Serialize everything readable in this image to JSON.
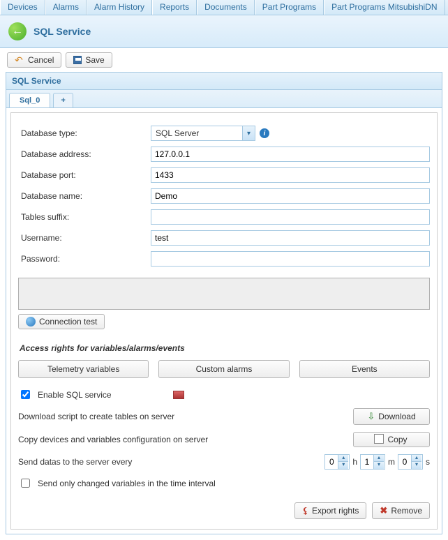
{
  "topTabs": [
    "Devices",
    "Alarms",
    "Alarm History",
    "Reports",
    "Documents",
    "Part Programs",
    "Part Programs MitsubishiDN"
  ],
  "titleBar": {
    "title": "SQL Service"
  },
  "toolbar": {
    "cancel": "Cancel",
    "save": "Save"
  },
  "panel": {
    "header": "SQL Service"
  },
  "innerTabs": {
    "tab0": "Sql_0",
    "add": "+"
  },
  "form": {
    "labels": {
      "dbType": "Database type:",
      "dbAddress": "Database address:",
      "dbPort": "Database port:",
      "dbName": "Database name:",
      "suffix": "Tables suffix:",
      "username": "Username:",
      "password": "Password:"
    },
    "values": {
      "dbType": "SQL Server",
      "dbAddress": "127.0.0.1",
      "dbPort": "1433",
      "dbName": "Demo",
      "suffix": "",
      "username": "test",
      "password": ""
    }
  },
  "connTest": "Connection test",
  "accessTitle": "Access rights for variables/alarms/events",
  "accessBtns": {
    "telemetry": "Telemetry variables",
    "alarms": "Custom alarms",
    "events": "Events"
  },
  "enableLabel": "Enable SQL service",
  "downloadRow": {
    "label": "Download script to create tables on server",
    "btn": "Download"
  },
  "copyRow": {
    "label": "Copy devices and variables configuration on server",
    "btn": "Copy"
  },
  "sendRow": {
    "label": "Send datas to the server every",
    "h": "0",
    "hUnit": "h",
    "m": "1",
    "mUnit": "m",
    "s": "0",
    "sUnit": "s"
  },
  "sendOnly": "Send only changed variables in the time interval",
  "footer": {
    "export": "Export rights",
    "remove": "Remove"
  }
}
